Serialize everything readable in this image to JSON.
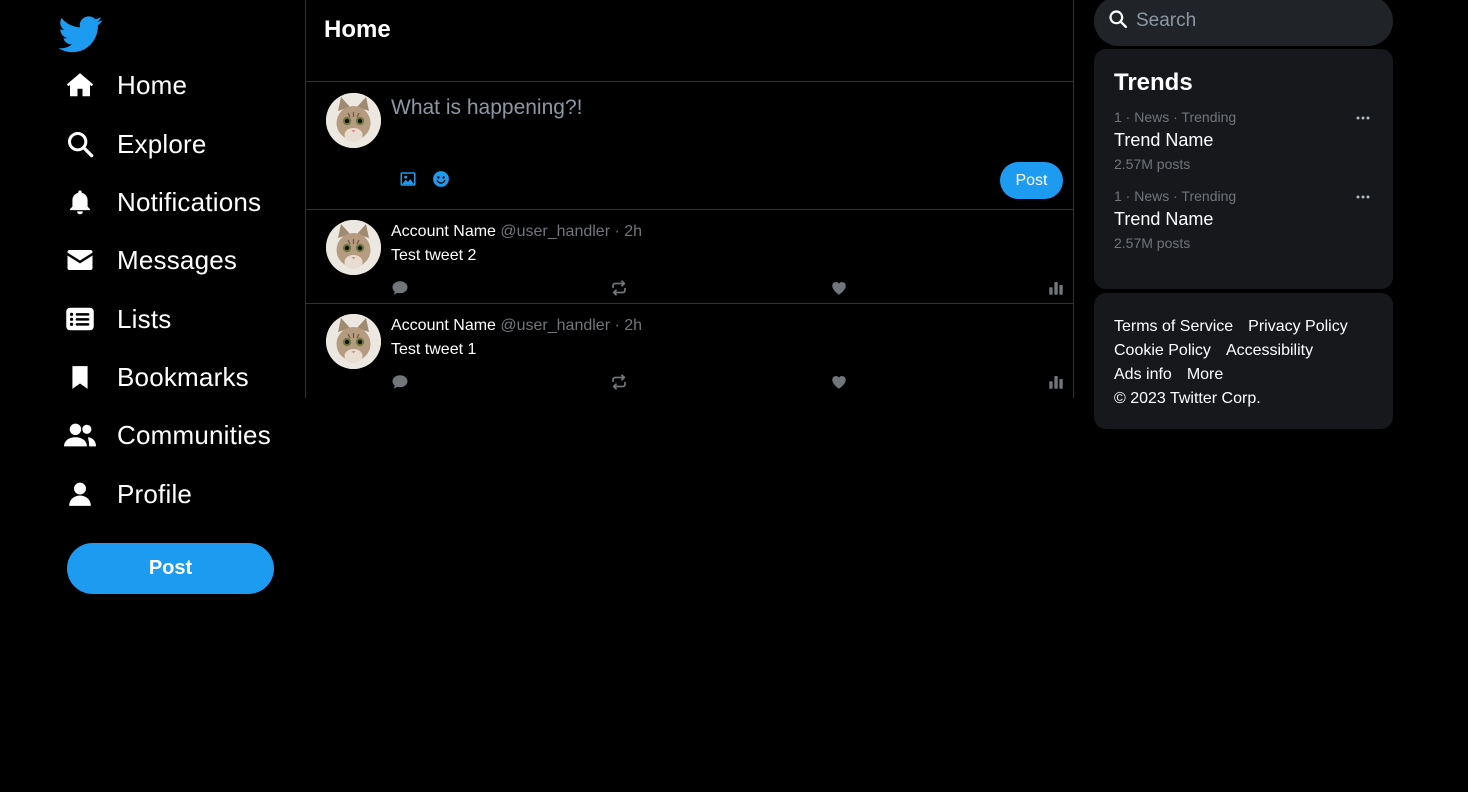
{
  "nav": {
    "items": [
      {
        "label": "Home",
        "icon": "home-icon"
      },
      {
        "label": "Explore",
        "icon": "search-icon"
      },
      {
        "label": "Notifications",
        "icon": "bell-icon"
      },
      {
        "label": "Messages",
        "icon": "envelope-icon"
      },
      {
        "label": "Lists",
        "icon": "list-icon"
      },
      {
        "label": "Bookmarks",
        "icon": "bookmark-icon"
      },
      {
        "label": "Communities",
        "icon": "users-icon"
      },
      {
        "label": "Profile",
        "icon": "user-icon"
      }
    ],
    "post_label": "Post"
  },
  "center": {
    "title": "Home",
    "composer": {
      "placeholder": "What is happening?!",
      "post_label": "Post"
    },
    "tweets": [
      {
        "name": "Account Name",
        "handle": "@user_handler",
        "sep": "·",
        "time": "2h",
        "text": "Test tweet 2"
      },
      {
        "name": "Account Name",
        "handle": "@user_handler",
        "sep": "·",
        "time": "2h",
        "text": "Test tweet 1"
      }
    ]
  },
  "right": {
    "search_placeholder": "Search",
    "trends_title": "Trends",
    "trends": [
      {
        "meta": "1 · News · Trending",
        "name": "Trend Name",
        "count": "2.57M posts"
      },
      {
        "meta": "1 · News · Trending",
        "name": "Trend Name",
        "count": "2.57M posts"
      }
    ],
    "footer": {
      "terms": "Terms of Service",
      "privacy": "Privacy Policy",
      "cookie": "Cookie Policy",
      "accessibility": "Accessibility",
      "ads": "Ads info",
      "more": "More",
      "copyright": "© 2023 Twitter Corp."
    }
  },
  "colors": {
    "accent": "#1d9bf0",
    "background": "#000000",
    "panel": "#16181c",
    "muted": "#71767b",
    "border": "#2f3336"
  }
}
